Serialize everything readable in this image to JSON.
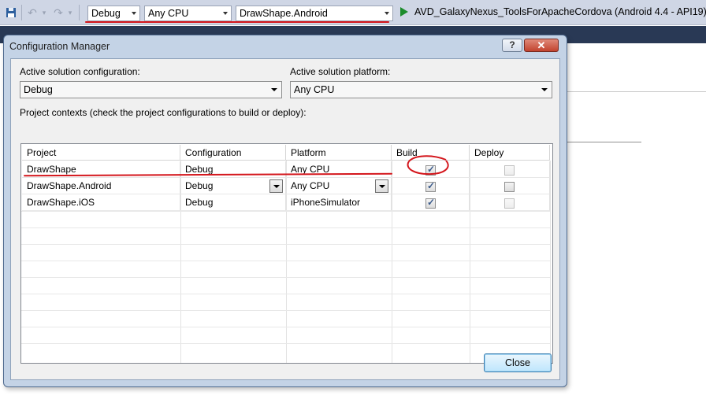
{
  "toolbar": {
    "configuration": "Debug",
    "platform": "Any CPU",
    "startup_project": "DrawShape.Android",
    "run_target": "AVD_GalaxyNexus_ToolsForApacheCordova (Android 4.4 - API19)"
  },
  "dialog": {
    "title": "Configuration Manager",
    "help_label": "?",
    "close_x_label": "✕",
    "active_config_label": "Active solution configuration:",
    "active_config_value": "Debug",
    "active_platform_label": "Active solution platform:",
    "active_platform_value": "Any CPU",
    "contexts_label": "Project contexts (check the project configurations to build or deploy):",
    "close_label": "Close"
  },
  "grid": {
    "headers": [
      "Project",
      "Configuration",
      "Platform",
      "Build",
      "Deploy"
    ],
    "rows": [
      {
        "project": "DrawShape",
        "configuration": "Debug",
        "platform": "Any CPU",
        "build": true,
        "deploy": false
      },
      {
        "project": "DrawShape.Android",
        "configuration": "Debug",
        "platform": "Any CPU",
        "build": true,
        "deploy": false
      },
      {
        "project": "DrawShape.iOS",
        "configuration": "Debug",
        "platform": "iPhoneSimulator",
        "build": true,
        "deploy": false
      }
    ]
  },
  "colors": {
    "annotation": "#d4161c",
    "toolbar_bg": "#cfd6e5",
    "dialog_frame": "#c4d3e6"
  }
}
